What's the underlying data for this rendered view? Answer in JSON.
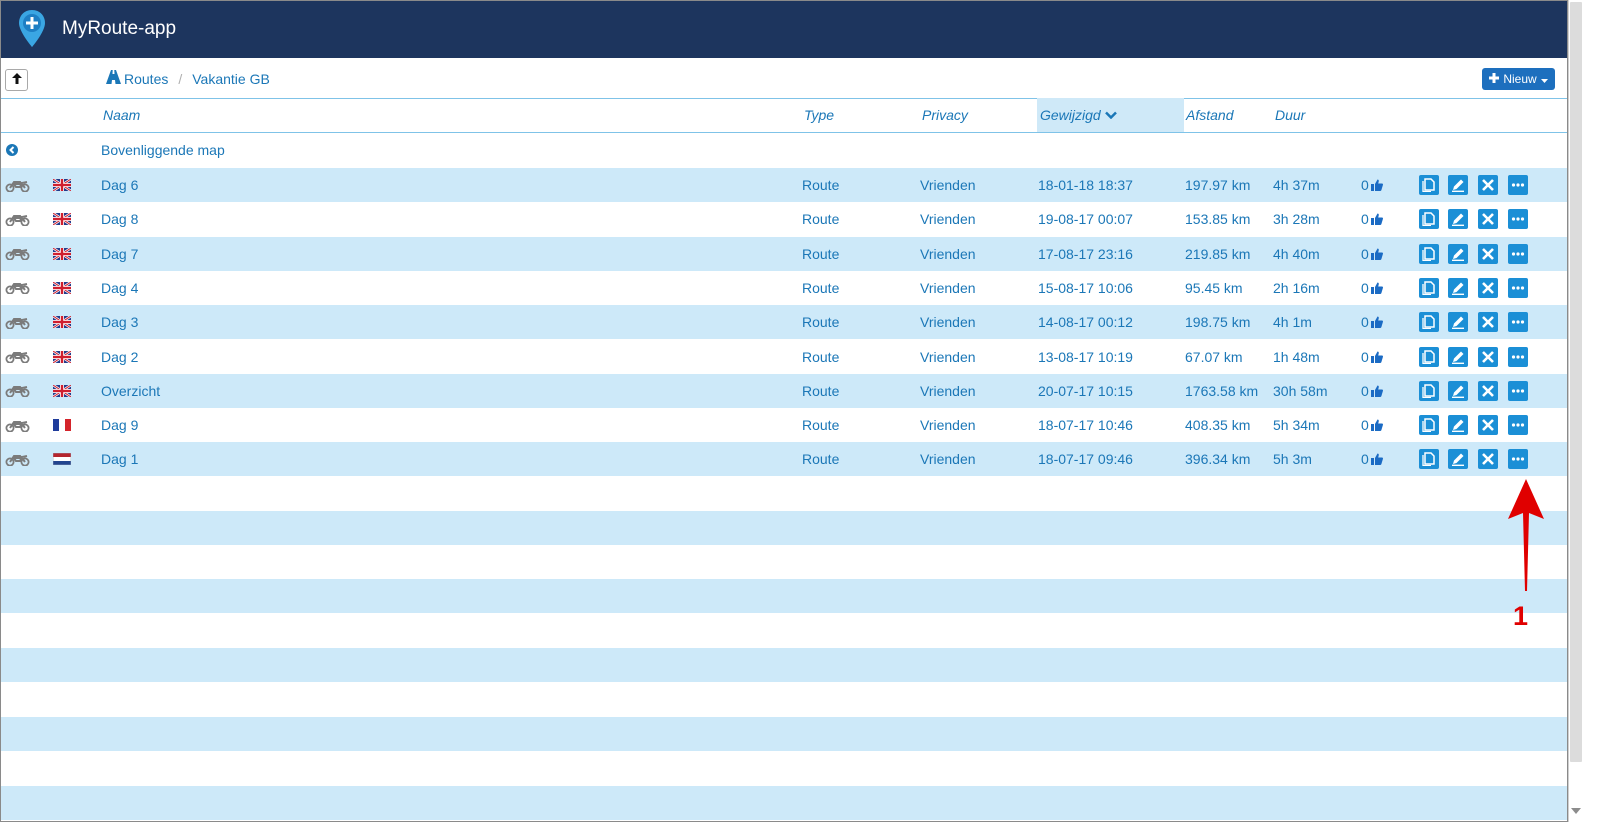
{
  "app": {
    "title": "MyRoute-app"
  },
  "breadcrumb": {
    "root": "Routes",
    "current": "Vakantie GB"
  },
  "toolbar": {
    "new_label": "Nieuw"
  },
  "columns": {
    "name": "Naam",
    "type": "Type",
    "privacy": "Privacy",
    "modified": "Gewijzigd",
    "distance": "Afstand",
    "duration": "Duur"
  },
  "parent_folder": {
    "label": "Bovenliggende map"
  },
  "rows": [
    {
      "name": "Dag 6",
      "flag": "gb",
      "type": "Route",
      "privacy": "Vrienden",
      "modified": "18-01-18 18:37",
      "distance": "197.97 km",
      "duration": "4h 37m",
      "likes": "0"
    },
    {
      "name": "Dag 8",
      "flag": "gb",
      "type": "Route",
      "privacy": "Vrienden",
      "modified": "19-08-17 00:07",
      "distance": "153.85 km",
      "duration": "3h 28m",
      "likes": "0"
    },
    {
      "name": "Dag 7",
      "flag": "gb",
      "type": "Route",
      "privacy": "Vrienden",
      "modified": "17-08-17 23:16",
      "distance": "219.85 km",
      "duration": "4h 40m",
      "likes": "0"
    },
    {
      "name": "Dag 4",
      "flag": "gb",
      "type": "Route",
      "privacy": "Vrienden",
      "modified": "15-08-17 10:06",
      "distance": "95.45 km",
      "duration": "2h 16m",
      "likes": "0"
    },
    {
      "name": "Dag 3",
      "flag": "gb",
      "type": "Route",
      "privacy": "Vrienden",
      "modified": "14-08-17 00:12",
      "distance": "198.75 km",
      "duration": "4h 1m",
      "likes": "0"
    },
    {
      "name": "Dag 2",
      "flag": "gb",
      "type": "Route",
      "privacy": "Vrienden",
      "modified": "13-08-17 10:19",
      "distance": "67.07 km",
      "duration": "1h 48m",
      "likes": "0"
    },
    {
      "name": "Overzicht",
      "flag": "gb",
      "type": "Route",
      "privacy": "Vrienden",
      "modified": "20-07-17 10:15",
      "distance": "1763.58 km",
      "duration": "30h 58m",
      "likes": "0"
    },
    {
      "name": "Dag 9",
      "flag": "fr",
      "type": "Route",
      "privacy": "Vrienden",
      "modified": "18-07-17 10:46",
      "distance": "408.35 km",
      "duration": "5h 34m",
      "likes": "0"
    },
    {
      "name": "Dag 1",
      "flag": "nl",
      "type": "Route",
      "privacy": "Vrienden",
      "modified": "18-07-17 09:46",
      "distance": "396.34 km",
      "duration": "5h 3m",
      "likes": "0"
    }
  ],
  "row_icons": {
    "vehicle": "motorcycle-icon",
    "actions": [
      "copy-icon",
      "edit-icon",
      "delete-icon",
      "more-icon"
    ]
  },
  "annotation": {
    "label": "1"
  },
  "colors": {
    "header_bg": "#1d355e",
    "link": "#1b77b7",
    "row_alt": "#cde9f9",
    "action_bg": "#1b8fd6",
    "annotation": "#e00000"
  }
}
